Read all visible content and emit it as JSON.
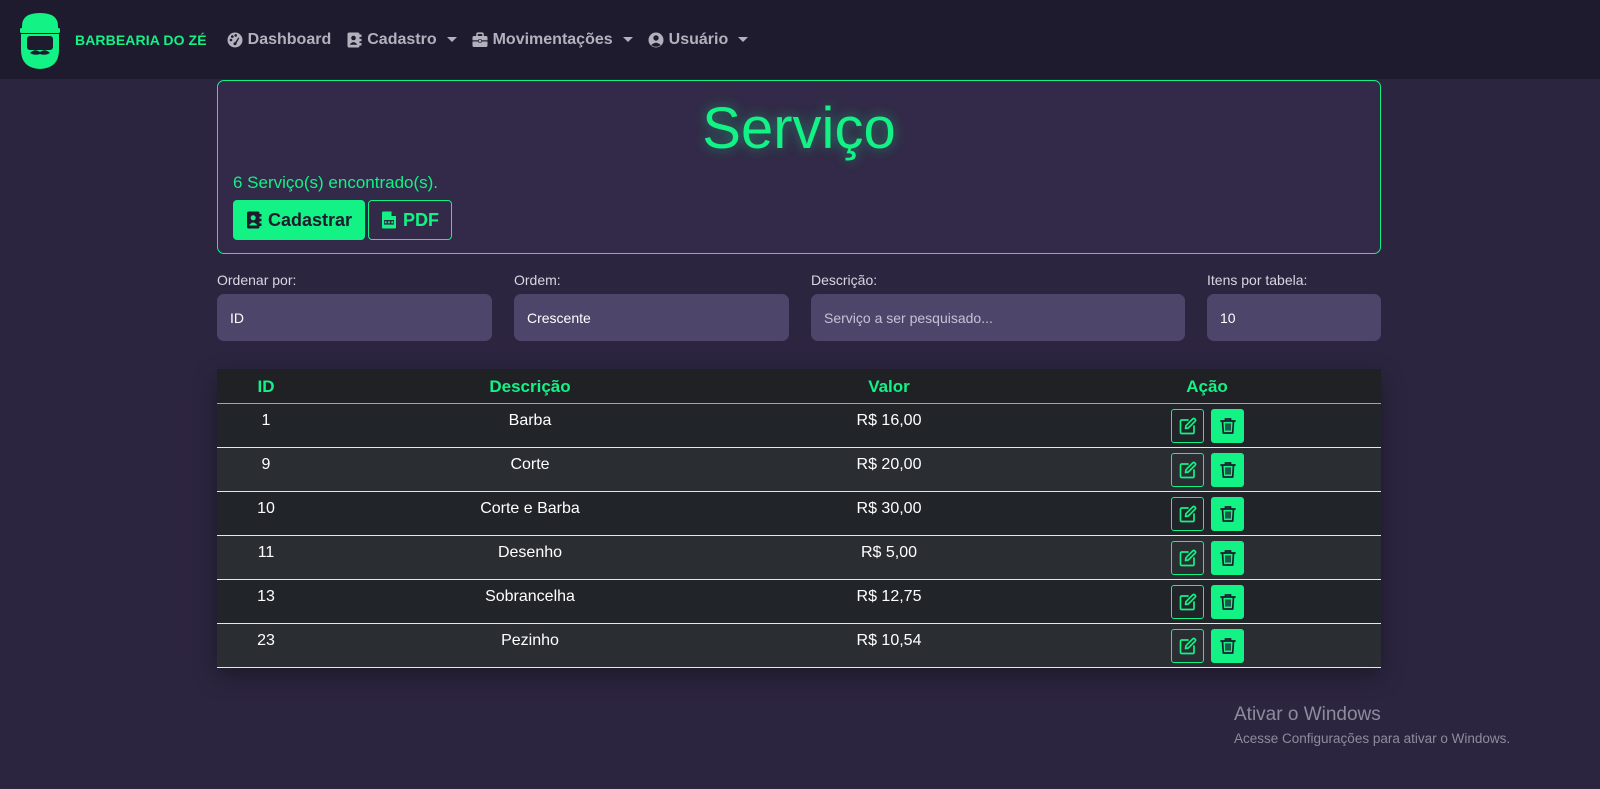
{
  "navbar": {
    "brand": "BARBEARIA DO ZÉ",
    "items": [
      {
        "label": "Dashboard",
        "icon": "dashboard-icon",
        "dropdown": false
      },
      {
        "label": "Cadastro",
        "icon": "address-book-icon",
        "dropdown": true
      },
      {
        "label": "Movimentações",
        "icon": "briefcase-icon",
        "dropdown": true
      },
      {
        "label": "Usuário",
        "icon": "user-circle-icon",
        "dropdown": true
      }
    ]
  },
  "header": {
    "title": "Serviço",
    "count_text": "6 Serviço(s) encontrado(s).",
    "register_label": "Cadastrar",
    "pdf_label": "PDF"
  },
  "filters": {
    "order_by": {
      "label": "Ordenar por:",
      "value": "ID"
    },
    "order": {
      "label": "Ordem:",
      "value": "Crescente"
    },
    "description": {
      "label": "Descrição:",
      "placeholder": "Serviço a ser pesquisado..."
    },
    "per_page": {
      "label": "Itens por tabela:",
      "value": "10"
    }
  },
  "table": {
    "headers": {
      "id": "ID",
      "description": "Descrição",
      "value": "Valor",
      "action": "Ação"
    },
    "rows": [
      {
        "id": "1",
        "description": "Barba",
        "value": "R$ 16,00"
      },
      {
        "id": "9",
        "description": "Corte",
        "value": "R$ 20,00"
      },
      {
        "id": "10",
        "description": "Corte e Barba",
        "value": "R$ 30,00"
      },
      {
        "id": "11",
        "description": "Desenho",
        "value": "R$ 5,00"
      },
      {
        "id": "13",
        "description": "Sobrancelha",
        "value": "R$ 12,75"
      },
      {
        "id": "23",
        "description": "Pezinho",
        "value": "R$ 10,54"
      }
    ]
  },
  "watermark": {
    "title": "Ativar o Windows",
    "subtitle": "Acesse Configurações para ativar o Windows."
  },
  "colors": {
    "accent": "#12f285",
    "background": "#2c2540",
    "navbar": "#1f1b2e"
  }
}
